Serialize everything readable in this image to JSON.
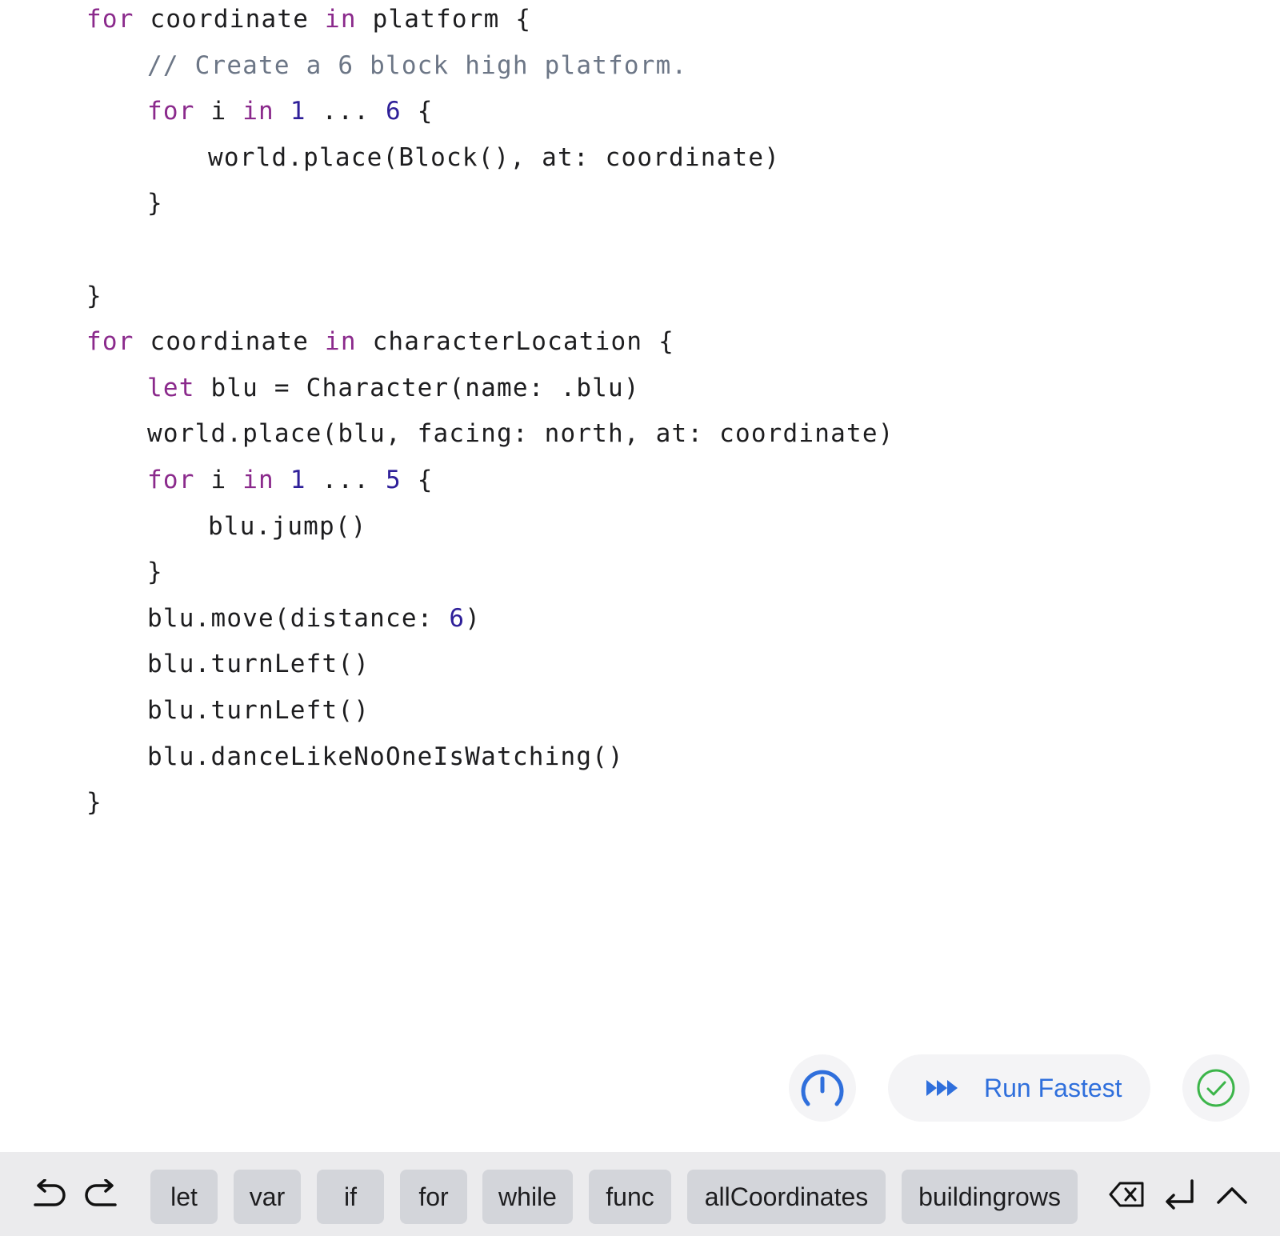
{
  "code_lines": [
    [
      {
        "t": "for",
        "c": "kw"
      },
      {
        "t": " coordinate "
      },
      {
        "t": "in",
        "c": "kw"
      },
      {
        "t": " platform {"
      }
    ],
    [
      {
        "t": "// Create a 6 block high platform.",
        "c": "cm"
      }
    ],
    [
      {
        "t": "for",
        "c": "kw"
      },
      {
        "t": " i "
      },
      {
        "t": "in",
        "c": "kw"
      },
      {
        "t": " "
      },
      {
        "t": "1",
        "c": "num"
      },
      {
        "t": " ... "
      },
      {
        "t": "6",
        "c": "num"
      },
      {
        "t": " {"
      }
    ],
    [
      {
        "t": "world.place(Block(), at: coordinate)"
      }
    ],
    [
      {
        "t": "}"
      }
    ],
    [],
    [
      {
        "t": "}"
      }
    ],
    [
      {
        "t": "for",
        "c": "kw"
      },
      {
        "t": " coordinate "
      },
      {
        "t": "in",
        "c": "kw"
      },
      {
        "t": " characterLocation {"
      }
    ],
    [
      {
        "t": "let",
        "c": "kw"
      },
      {
        "t": " blu = Character(name: .blu)"
      }
    ],
    [
      {
        "t": "world.place(blu, facing: north, at: coordinate)"
      }
    ],
    [
      {
        "t": "for",
        "c": "kw"
      },
      {
        "t": " i "
      },
      {
        "t": "in",
        "c": "kw"
      },
      {
        "t": " "
      },
      {
        "t": "1",
        "c": "num"
      },
      {
        "t": " ... "
      },
      {
        "t": "5",
        "c": "num"
      },
      {
        "t": " {"
      }
    ],
    [
      {
        "t": "blu.jump()"
      }
    ],
    [
      {
        "t": "}"
      }
    ],
    [
      {
        "t": "blu.move(distance: "
      },
      {
        "t": "6",
        "c": "num"
      },
      {
        "t": ")"
      }
    ],
    [
      {
        "t": "blu.turnLeft()"
      }
    ],
    [
      {
        "t": "blu.turnLeft()"
      }
    ],
    [
      {
        "t": "blu.danceLikeNoOneIsWatching()"
      }
    ],
    [
      {
        "t": "}"
      }
    ]
  ],
  "controls": {
    "speed_icon": "speedometer-icon",
    "run_label": "Run Fastest",
    "run_icon": "fast-forward-icon",
    "check_icon": "checkmark-circle-icon"
  },
  "toolbar": {
    "undo_icon": "undo-icon",
    "redo_icon": "redo-icon",
    "chips": [
      "let",
      "var",
      "if",
      "for",
      "while",
      "func",
      "allCoordinates",
      "buildingrows"
    ],
    "delete_icon": "delete-backward-icon",
    "return_icon": "return-icon",
    "collapse_icon": "chevron-up-icon"
  },
  "colors": {
    "keyword": "#8b2a8c",
    "number": "#2e1f99",
    "comment": "#6c7686",
    "accent": "#2f6fdc",
    "success": "#3cb54a"
  }
}
